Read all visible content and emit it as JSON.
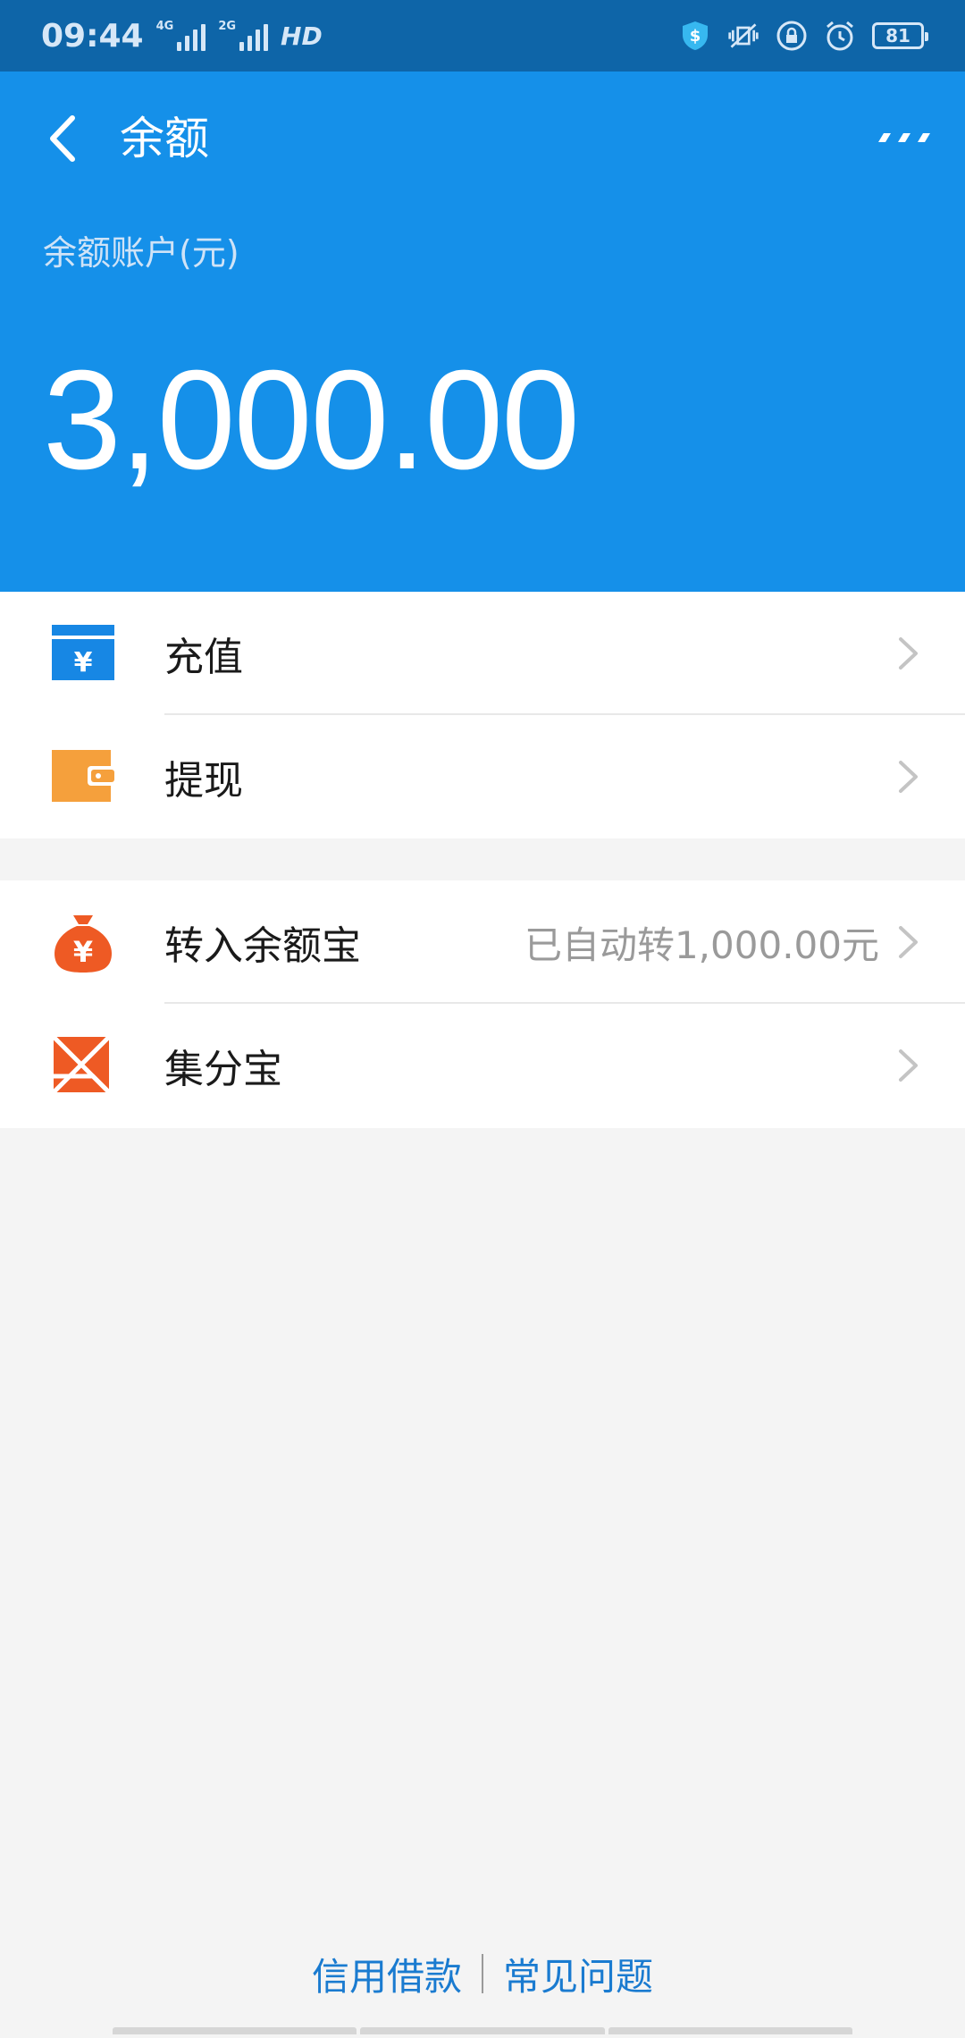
{
  "status_bar": {
    "time": "09:44",
    "network_1": "4G",
    "network_2": "2G",
    "hd": "HD",
    "battery": "81"
  },
  "header": {
    "title": "余额",
    "account_label": "余额账户(元)",
    "balance": "3,000.00"
  },
  "menu_group_1": [
    {
      "label": "充值",
      "icon": "recharge-icon"
    },
    {
      "label": "提现",
      "icon": "withdraw-wallet-icon"
    }
  ],
  "menu_group_2": [
    {
      "label": "转入余额宝",
      "sub": "已自动转1,000.00元",
      "icon": "money-bag-icon"
    },
    {
      "label": "集分宝",
      "icon": "jifenbao-icon"
    }
  ],
  "footer": {
    "credit_loan": "信用借款",
    "faq": "常见问题"
  },
  "colors": {
    "header_bg": "#1590e9",
    "status_bg": "#0e65a8",
    "recharge_blue": "#1787e4",
    "withdraw_orange": "#f5a03c",
    "bag_red": "#ee5a24",
    "link_blue": "#1a7bd0"
  }
}
